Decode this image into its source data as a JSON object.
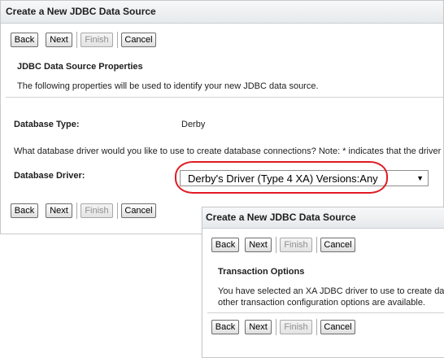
{
  "main": {
    "title": "Create a New JDBC Data Source",
    "buttons": {
      "back": "Back",
      "next": "Next",
      "finish": "Finish",
      "cancel": "Cancel"
    },
    "properties": {
      "heading": "JDBC Data Source Properties",
      "description": "The following properties will be used to identify your new JDBC data source."
    },
    "database_type": {
      "label": "Database Type:",
      "value": "Derby"
    },
    "driver_prompt": "What database driver would you like to use to create database connections? Note: * indicates that the driver",
    "database_driver": {
      "label": "Database Driver:",
      "selected": "Derby's Driver (Type 4 XA) Versions:Any"
    }
  },
  "overlay": {
    "title": "Create a New JDBC Data Source",
    "buttons": {
      "back": "Back",
      "next": "Next",
      "finish": "Finish",
      "cancel": "Cancel"
    },
    "transaction": {
      "heading": "Transaction Options",
      "line1": "You have selected an XA JDBC driver to use to create da",
      "line2": "other transaction configuration options are available."
    }
  },
  "colors": {
    "highlight": "#e01b24",
    "title_bar": "#e6e9ec"
  },
  "icons": {
    "dropdown": "chevron-down-icon"
  }
}
